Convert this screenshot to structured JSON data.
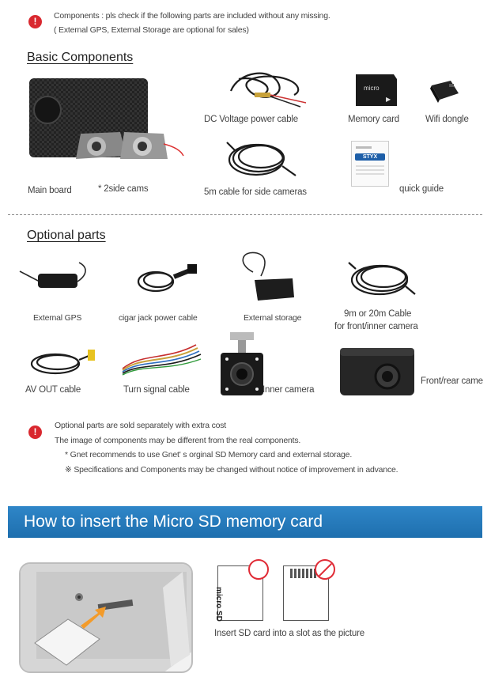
{
  "intro": {
    "line1": "Components : pls check if the following parts are included without any missing.",
    "line2": "( External GPS, External Storage are optional for sales)"
  },
  "basic": {
    "title": "Basic Components",
    "items": {
      "main_board": "Main board",
      "side_cams": "* 2side cams",
      "dc_cable": "DC Voltage power cable",
      "memory_card": "Memory card",
      "wifi_dongle": "Wifi dongle",
      "side_cable": "5m cable for side cameras",
      "quick_guide": "quick guide"
    },
    "guide_brand": "STYX"
  },
  "optional": {
    "title": "Optional parts",
    "items": {
      "gps": "External GPS",
      "cigar": "cigar jack power cable",
      "storage": "External storage",
      "cable_9m_line1": "9m or 20m Cable",
      "cable_9m_line2": "for front/inner camera",
      "av_out": "AV OUT cable",
      "turn_signal": "Turn signal cable",
      "inner_camera": "Inner camera",
      "front_rear": "Front/rear came"
    }
  },
  "notes": {
    "line1": "Optional parts are sold separately with extra cost",
    "line2": "The image of components may be different from the real components.",
    "line3": "* Gnet recommends to use Gnet' s orginal SD Memory card and external storage.",
    "line4": "※ Specifications and Components may be changed without notice of improvement in advance."
  },
  "sd_section": {
    "title": "How to insert the Micro SD memory card",
    "instruction": "Insert SD card into a slot as the picture",
    "card_text": "micro SD"
  },
  "colors": {
    "warning": "#d9282f",
    "banner": "#2a7fc0",
    "arrow": "#f39b2a"
  }
}
